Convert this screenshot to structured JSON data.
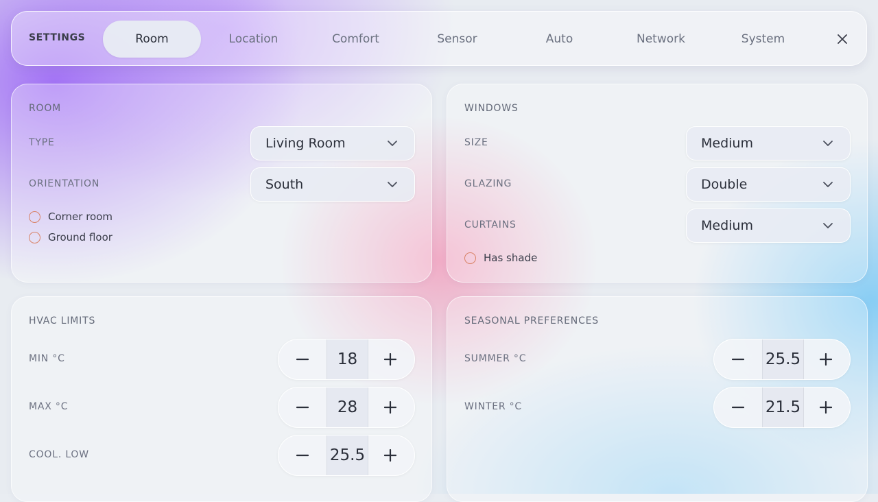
{
  "header": {
    "title": "SETTINGS",
    "tabs": [
      {
        "label": "Room",
        "active": true
      },
      {
        "label": "Location"
      },
      {
        "label": "Comfort"
      },
      {
        "label": "Sensor"
      },
      {
        "label": "Auto"
      },
      {
        "label": "Network"
      },
      {
        "label": "System"
      }
    ],
    "close_icon": "close-icon"
  },
  "room": {
    "title": "ROOM",
    "type_label": "TYPE",
    "type_value": "Living Room",
    "orientation_label": "ORIENTATION",
    "orientation_value": "South",
    "checkboxes": [
      {
        "label": "Corner room",
        "checked": false
      },
      {
        "label": "Ground floor",
        "checked": false
      }
    ]
  },
  "windows": {
    "title": "WINDOWS",
    "size_label": "SIZE",
    "size_value": "Medium",
    "glazing_label": "GLAZING",
    "glazing_value": "Double",
    "curtains_label": "CURTAINS",
    "curtains_value": "Medium",
    "checkboxes": [
      {
        "label": "Has shade",
        "checked": false
      }
    ]
  },
  "hvac": {
    "title": "HVAC LIMITS",
    "rows": [
      {
        "label": "MIN °C",
        "value": "18"
      },
      {
        "label": "MAX °C",
        "value": "28"
      },
      {
        "label": "COOL. LOW",
        "value": "25.5"
      }
    ]
  },
  "seasonal": {
    "title": "SEASONAL PREFERENCES",
    "rows": [
      {
        "label": "SUMMER °C",
        "value": "25.5"
      },
      {
        "label": "WINTER °C",
        "value": "21.5"
      }
    ]
  },
  "colors": {
    "checkbox_ring": "#d98266",
    "text_primary": "#2b2f3a",
    "label_muted": "#6b7080"
  }
}
